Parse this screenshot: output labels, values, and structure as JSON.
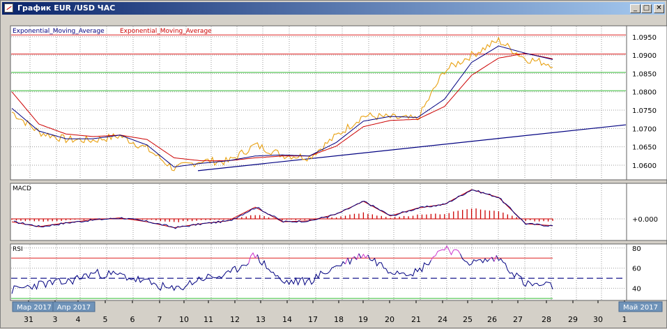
{
  "window": {
    "title": "График EUR /USD  ЧАС",
    "minimize_label": "_",
    "maximize_label": "□",
    "close_label": "✕"
  },
  "colors": {
    "price": "#e8a010",
    "ema_fast": "#000080",
    "ema_slow": "#cc0000",
    "trendline": "#000080",
    "resistance": "#dd2020",
    "support": "#33bb33",
    "rsi": "#000080",
    "rsi_overbought": "#cc33cc",
    "rsi_oversold": "#33bb33",
    "macd_hist": "#cc0000"
  },
  "main_panel": {
    "legend_fast": "Exponential_Moving_Average",
    "legend_slow": "Exponential_Moving_Average",
    "y_ticks": [
      "1.0950",
      "1.0900",
      "1.0850",
      "1.0800",
      "1.0750",
      "1.0700",
      "1.0650",
      "1.0600"
    ]
  },
  "macd_panel": {
    "label": "MACD",
    "y_ticks": [
      "+0.000"
    ]
  },
  "rsi_panel": {
    "label": "RSI",
    "y_ticks": [
      "80",
      "60",
      "40"
    ]
  },
  "x_axis": {
    "month_labels": [
      "Мар 2017",
      "Апр 2017",
      "Май 2017"
    ],
    "day_labels": [
      "31",
      "3",
      "4",
      "5",
      "6",
      "7",
      "10",
      "11",
      "12",
      "13",
      "14",
      "17",
      "18",
      "19",
      "20",
      "21",
      "24",
      "25",
      "26",
      "27",
      "28",
      "29",
      "30",
      "1"
    ]
  },
  "chart_data": [
    {
      "type": "line",
      "title": "",
      "x": [
        "31",
        "3",
        "4",
        "5",
        "6",
        "7",
        "10",
        "11",
        "12",
        "13",
        "14",
        "17",
        "18",
        "19",
        "20",
        "21",
        "24",
        "25",
        "26",
        "27",
        "28"
      ],
      "series": [
        {
          "name": "Exponential_Moving_Average",
          "values": [
            1.0755,
            1.0693,
            1.0672,
            1.0672,
            1.0682,
            1.0655,
            1.0595,
            1.0605,
            1.0612,
            1.0625,
            1.0628,
            1.0625,
            1.0662,
            1.072,
            1.0733,
            1.073,
            1.078,
            1.088,
            1.0925,
            1.0905,
            1.0888
          ]
        },
        {
          "name": "Exponential_Moving_Average",
          "values": [
            1.08,
            1.0712,
            1.0685,
            1.0678,
            1.0682,
            1.067,
            1.062,
            1.0612,
            1.0612,
            1.062,
            1.0625,
            1.0625,
            1.0652,
            1.0705,
            1.0722,
            1.0725,
            1.076,
            1.0845,
            1.0892,
            1.0905,
            1.089
          ]
        }
      ],
      "price_close": [
        1.0745,
        1.069,
        1.067,
        1.0668,
        1.068,
        1.0645,
        1.059,
        1.0612,
        1.061,
        1.0655,
        1.0628,
        1.0622,
        1.068,
        1.0735,
        1.073,
        1.0725,
        1.0858,
        1.09,
        1.094,
        1.089,
        1.0875
      ],
      "horizontal_levels": {
        "resistance": [
          1.0955,
          1.0903
        ],
        "support": [
          1.0853,
          1.0803
        ]
      },
      "trendline": {
        "start": [
          "10",
          1.0585
        ],
        "end": [
          "1",
          1.071
        ]
      },
      "ylim": [
        1.056,
        1.098
      ]
    },
    {
      "type": "line",
      "title": "",
      "x": [
        "31",
        "3",
        "4",
        "5",
        "6",
        "7",
        "10",
        "11",
        "12",
        "13",
        "14",
        "17",
        "18",
        "19",
        "20",
        "21",
        "24",
        "25",
        "26",
        "27",
        "28"
      ],
      "series": [
        {
          "name": "MACD",
          "values": [
            -0.0003,
            -0.0008,
            -0.0004,
            -0.0001,
            0.0001,
            -0.0003,
            -0.0009,
            -0.0005,
            -0.0002,
            0.0012,
            -0.0003,
            -0.0002,
            0.0005,
            0.0018,
            0.0003,
            0.0011,
            0.0015,
            0.003,
            0.0022,
            -0.0005,
            -0.0007
          ]
        }
      ],
      "y_ticks": [
        "+0.000"
      ]
    },
    {
      "type": "line",
      "title": "",
      "x": [
        "31",
        "3",
        "4",
        "5",
        "6",
        "7",
        "10",
        "11",
        "12",
        "13",
        "14",
        "17",
        "18",
        "19",
        "20",
        "21",
        "24",
        "25",
        "26",
        "27",
        "28"
      ],
      "series": [
        {
          "name": "RSI",
          "values": [
            38,
            44,
            46,
            55,
            53,
            46,
            38,
            50,
            53,
            73,
            46,
            47,
            62,
            74,
            58,
            56,
            82,
            65,
            70,
            44,
            42
          ]
        }
      ],
      "levels": [
        70,
        50,
        30
      ],
      "ylim": [
        28,
        84
      ]
    }
  ]
}
